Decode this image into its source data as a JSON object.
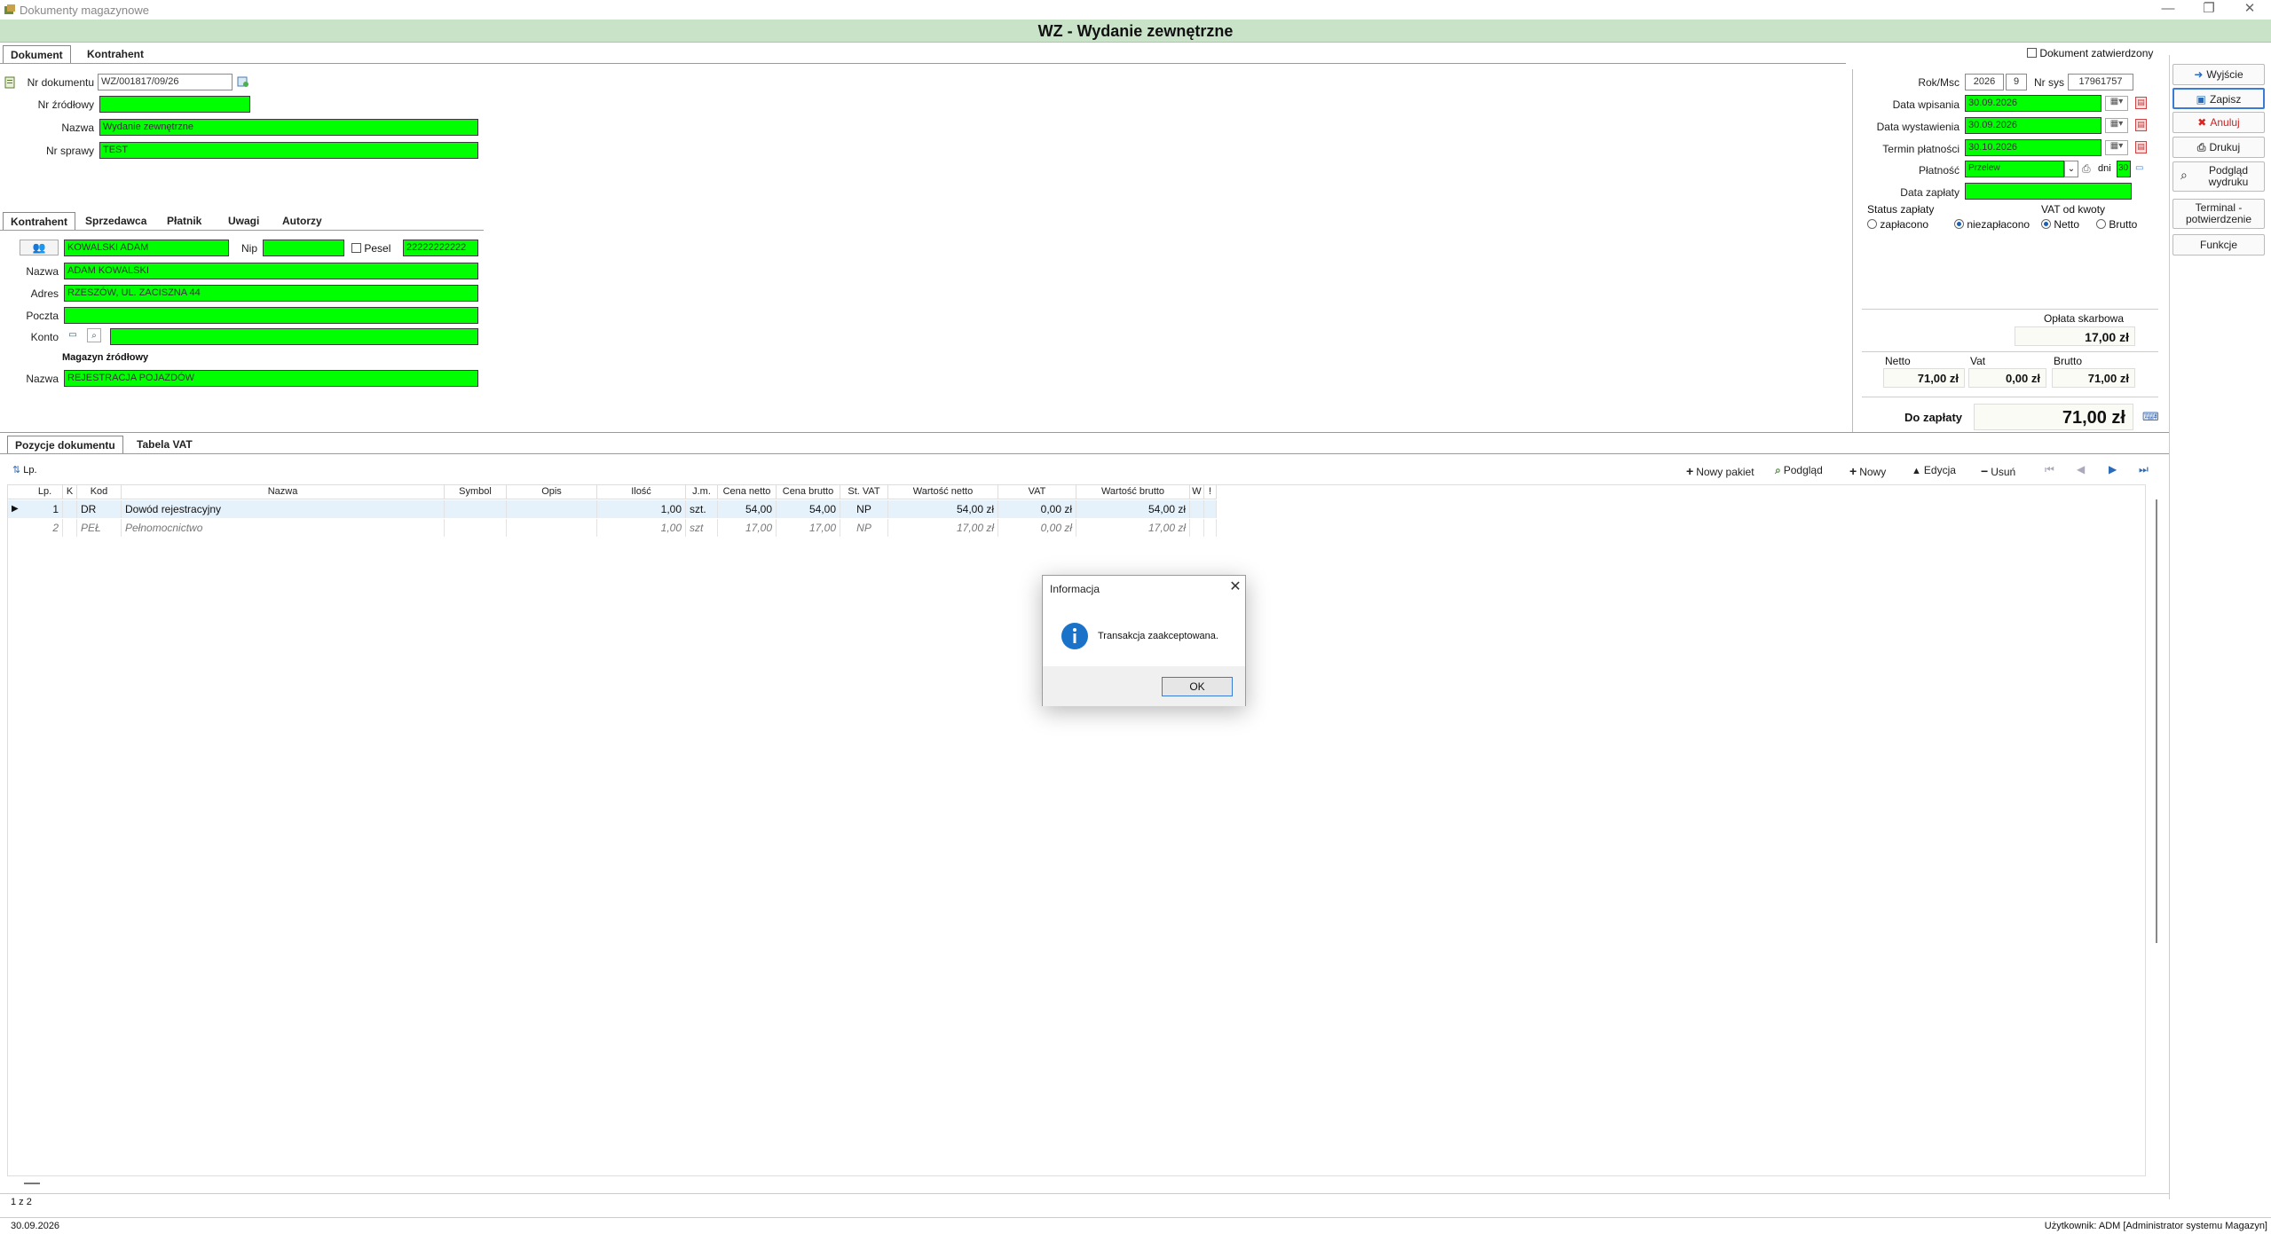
{
  "window": {
    "title": "Dokumenty magazynowe",
    "minimize": "—",
    "restore": "❐",
    "close": "✕"
  },
  "header": {
    "title": "WZ - Wydanie zewnętrzne"
  },
  "doc_tabs": [
    "Dokument",
    "Kontrahent"
  ],
  "confirmed_label": "Dokument zatwierdzony",
  "document": {
    "nr_dokumentu_label": "Nr dokumentu",
    "nr_dokumentu": "WZ/001817/09/26",
    "nr_zrodlowy_label": "Nr źródłowy",
    "nr_zrodlowy": "",
    "nazwa_label": "Nazwa",
    "nazwa": "Wydanie zewnętrzne",
    "nr_sprawy_label": "Nr sprawy",
    "nr_sprawy": "TEST"
  },
  "sub_tabs": [
    "Kontrahent",
    "Sprzedawca",
    "Płatnik",
    "Uwagi",
    "Autorzy"
  ],
  "kontrahent": {
    "name_short": "KOWALSKI ADAM",
    "nip_label": "Nip",
    "nip": "",
    "pesel_label": "Pesel",
    "pesel": "22222222222",
    "nazwa_label": "Nazwa",
    "nazwa": "ADAM KOWALSKI",
    "adres_label": "Adres",
    "adres": "RZESZÓW, UL. ZACISZNA 44",
    "poczta_label": "Poczta",
    "poczta": "",
    "konto_label": "Konto",
    "konto": ""
  },
  "magazyn": {
    "heading": "Magazyn źródłowy",
    "nazwa_label": "Nazwa",
    "nazwa": "REJESTRACJA POJAZDÓW"
  },
  "right_panel": {
    "rok_msc_label": "Rok/Msc",
    "rok": "2026",
    "msc": "9",
    "nr_sys_label": "Nr sys",
    "nr_sys": "17961757",
    "data_wpisania_label": "Data wpisania",
    "data_wpisania": "30.09.2026",
    "data_wystawienia_label": "Data wystawienia",
    "data_wystawienia": "30.09.2026",
    "termin_platnosci_label": "Termin płatności",
    "termin_platnosci": "30.10.2026",
    "platnosc_label": "Płatność",
    "platnosc": "Przelew",
    "dni_label": "dni",
    "dni": "30",
    "data_zaplaty_label": "Data zapłaty",
    "data_zaplaty": "",
    "status_label": "Status zapłaty",
    "status_options": [
      "zapłacono",
      "niezapłacono"
    ],
    "status_selected": "niezapłacono",
    "vat_label": "VAT od kwoty",
    "vat_options": [
      "Netto",
      "Brutto"
    ],
    "vat_selected": "Netto",
    "oplata_label": "Opłata skarbowa",
    "oplata": "17,00 zł",
    "netto_label": "Netto",
    "netto": "71,00 zł",
    "vat_sum_label": "Vat",
    "vat_sum": "0,00 zł",
    "brutto_label": "Brutto",
    "brutto": "71,00 zł",
    "do_zaplaty_label": "Do zapłaty",
    "do_zaplaty": "71,00 zł"
  },
  "actions": {
    "wyjscie": "Wyjście",
    "zapisz": "Zapisz",
    "anuluj": "Anuluj",
    "drukuj": "Drukuj",
    "podglad_wydruku": "Podgląd wydruku",
    "terminal": "Terminal - potwierdzenie",
    "funkcje": "Funkcje"
  },
  "bottom_tabs": [
    "Pozycje dokumentu",
    "Tabela VAT"
  ],
  "toolbar": {
    "lp": "Lp.",
    "nowy_pakiet": "Nowy pakiet",
    "podglad": "Podgląd",
    "nowy": "Nowy",
    "edycja": "Edycja",
    "usun": "Usuń"
  },
  "table": {
    "columns": [
      "Lp.",
      "K",
      "Kod",
      "Nazwa",
      "Symbol",
      "Opis",
      "Ilość",
      "J.m.",
      "Cena netto",
      "Cena brutto",
      "St. VAT",
      "Wartość netto",
      "VAT",
      "Wartość brutto",
      "W",
      "!"
    ],
    "rows": [
      [
        "1",
        "",
        "DR",
        "Dowód rejestracyjny",
        "",
        "",
        "1,00",
        "szt.",
        "54,00",
        "54,00",
        "NP",
        "54,00 zł",
        "0,00 zł",
        "54,00 zł",
        "",
        ""
      ],
      [
        "2",
        "",
        "PEŁ",
        "Pełnomocnictwo",
        "",
        "",
        "1,00",
        "szt",
        "17,00",
        "17,00",
        "NP",
        "17,00 zł",
        "0,00 zł",
        "17,00 zł",
        "",
        ""
      ]
    ],
    "count": "1 z 2"
  },
  "status_bar": {
    "date": "30.09.2026",
    "user": "Użytkownik: ADM [Administrator systemu Magazyn]"
  },
  "dialog": {
    "title": "Informacja",
    "message": "Transakcja zaakceptowana.",
    "ok": "OK",
    "close": "✕"
  },
  "colors": {
    "header_bg": "#c9e3c9",
    "field_green": "#00ff00",
    "row_selected": "#e6f2fb",
    "accent": "#3a7bd5"
  }
}
